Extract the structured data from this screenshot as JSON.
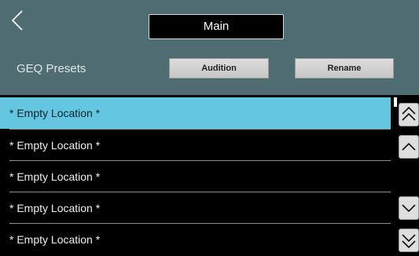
{
  "header": {
    "title": "Main",
    "section_label": "GEQ Presets",
    "audition_label": "Audition",
    "rename_label": "Rename",
    "back_icon": "chevron-left-icon"
  },
  "presets": {
    "items": [
      {
        "label": "* Empty Location *",
        "selected": true
      },
      {
        "label": "* Empty Location *",
        "selected": false
      },
      {
        "label": "* Empty Location *",
        "selected": false
      },
      {
        "label": "* Empty Location *",
        "selected": false
      },
      {
        "label": "* Empty Location *",
        "selected": false
      }
    ]
  },
  "scroll": {
    "icons": [
      "double-chevron-up-icon",
      "chevron-up-icon",
      "chevron-down-icon",
      "double-chevron-down-icon"
    ]
  },
  "colors": {
    "header_bg": "#4f6c72",
    "selected_row": "#64c6e0",
    "list_bg": "#000000"
  }
}
